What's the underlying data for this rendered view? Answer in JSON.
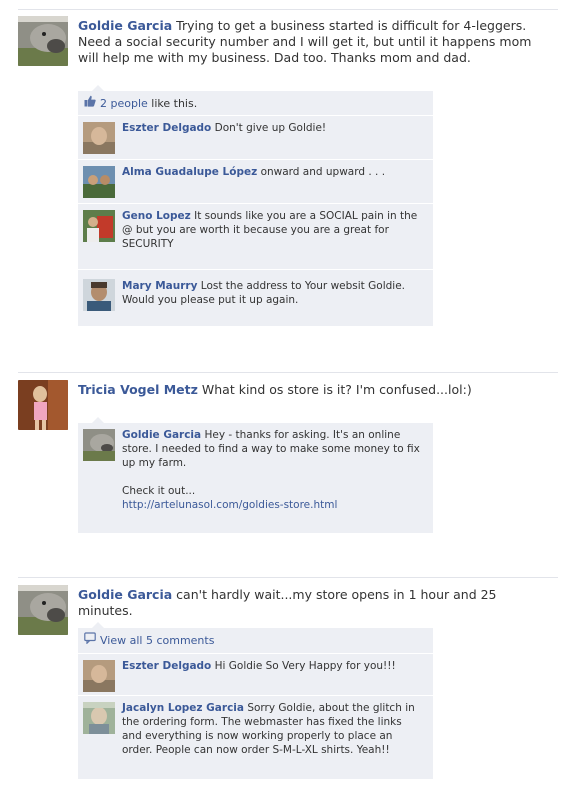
{
  "posts": [
    {
      "author": "Goldie Garcia",
      "text": "Trying to get a business started is difficult for 4-leggers. Need a social security number and I will get it, but until it happens mom will help me with my business. Dad too. Thanks mom and dad.",
      "likes": {
        "count_link": "2 people",
        "suffix": "like this."
      },
      "comments": [
        {
          "author": "Eszter Delgado",
          "text": "Don't give up Goldie!"
        },
        {
          "author": "Alma Guadalupe López",
          "text": "onward and upward . . ."
        },
        {
          "author": "Geno Lopez",
          "text": "It sounds like you are a SOCIAL pain in the @ but you are worth it because you are a great for SECURITY"
        },
        {
          "author": "Mary Maurry",
          "text": "Lost the address to Your websit Goldie. Would you please put it up again."
        }
      ]
    },
    {
      "author": "Tricia Vogel Metz",
      "text": "What kind os store is it? I'm confused...lol:)",
      "comments": [
        {
          "author": "Goldie Garcia",
          "text": "Hey - thanks for asking. It's an online store. I needed to find a way to make some money to fix up my farm.",
          "extra": "Check it out...",
          "link": "http://artelunasol.com/goldies-store.html"
        }
      ]
    },
    {
      "author": "Goldie Garcia",
      "text": "can't hardly wait...my store opens in 1 hour and 25 minutes.",
      "view_all": "View all 5 comments",
      "comments": [
        {
          "author": "Eszter Delgado",
          "text": "Hi Goldie So Very Happy for you!!!"
        },
        {
          "author": "Jacalyn Lopez Garcia",
          "text": "Sorry Goldie, about the glitch in the ordering form. The webmaster has fixed the links and everything is now working properly to place an order. People can now order S-M-L-XL shirts. Yeah!!"
        }
      ]
    }
  ],
  "icons": {
    "like": "thumbs-up-icon",
    "comments": "comment-bubble-icon"
  },
  "colors": {
    "link": "#3b5998",
    "panel": "#edeff4",
    "text": "#333333"
  }
}
